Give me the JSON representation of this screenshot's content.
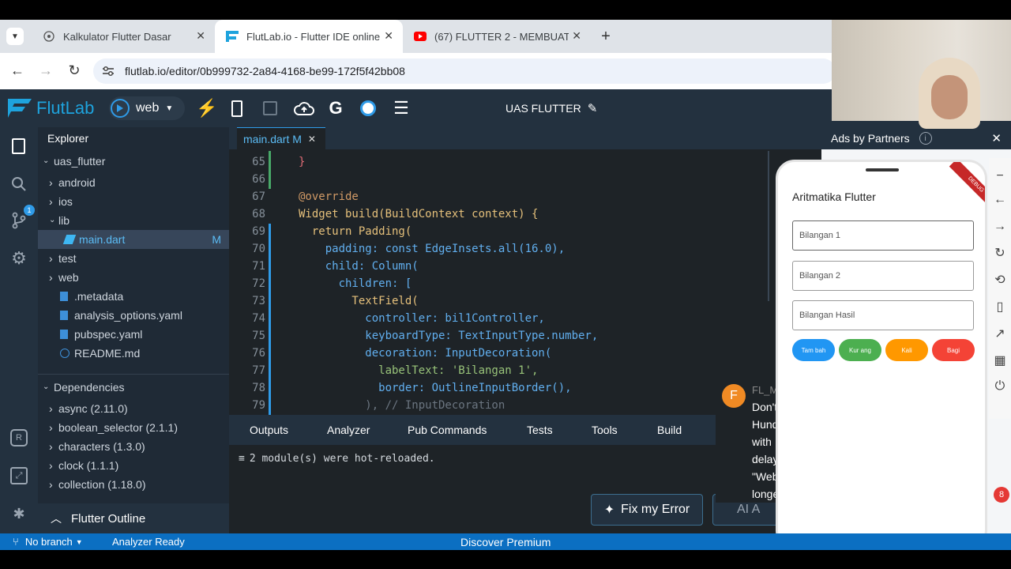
{
  "browser": {
    "tabs": [
      {
        "title": "Kalkulator Flutter Dasar"
      },
      {
        "title": "FlutLab.io - Flutter IDE online"
      },
      {
        "title": "(67) FLUTTER 2 - MEMBUAT KA"
      }
    ],
    "url": "flutlab.io/editor/0b999732-2a84-4168-be99-172f5f42bb08"
  },
  "toolbar": {
    "brand": "FlutLab",
    "target": "web",
    "project_title": "UAS FLUTTER"
  },
  "explorer": {
    "title": "Explorer",
    "root": "uas_flutter",
    "items": [
      {
        "label": "android"
      },
      {
        "label": "ios"
      },
      {
        "label": "lib"
      },
      {
        "label": "main.dart",
        "badge": "M"
      },
      {
        "label": "test"
      },
      {
        "label": "web"
      },
      {
        "label": ".metadata"
      },
      {
        "label": "analysis_options.yaml"
      },
      {
        "label": "pubspec.yaml"
      },
      {
        "label": "README.md"
      }
    ],
    "dependencies_title": "Dependencies",
    "dependencies": [
      {
        "label": "async (2.11.0)"
      },
      {
        "label": "boolean_selector (2.1.1)"
      },
      {
        "label": "characters (1.3.0)"
      },
      {
        "label": "clock (1.1.1)"
      },
      {
        "label": "collection (1.18.0)"
      }
    ],
    "outline_title": "Flutter Outline",
    "source_control_badge": "1"
  },
  "editor": {
    "tab_label": "main.dart M",
    "lines": [
      {
        "n": "65",
        "text": "}"
      },
      {
        "n": "66",
        "text": ""
      },
      {
        "n": "67",
        "text": "@override"
      },
      {
        "n": "68",
        "text": "Widget build(BuildContext context) {"
      },
      {
        "n": "69",
        "text": "  return Padding("
      },
      {
        "n": "70",
        "text": "    padding: const EdgeInsets.all(16.0),"
      },
      {
        "n": "71",
        "text": "    child: Column("
      },
      {
        "n": "72",
        "text": "      children: ["
      },
      {
        "n": "73",
        "text": "        TextField("
      },
      {
        "n": "74",
        "text": "          controller: bil1Controller,"
      },
      {
        "n": "75",
        "text": "          keyboardType: TextInputType.number,"
      },
      {
        "n": "76",
        "text": "          decoration: InputDecoration("
      },
      {
        "n": "77",
        "text": "            labelText: 'Bilangan 1',"
      },
      {
        "n": "78",
        "text": "            border: OutlineInputBorder(),"
      },
      {
        "n": "79",
        "text": "          ), // InputDecoration"
      }
    ]
  },
  "panel": {
    "tabs": [
      {
        "label": "Outputs"
      },
      {
        "label": "Analyzer"
      },
      {
        "label": "Pub Commands"
      },
      {
        "label": "Tests"
      },
      {
        "label": "Tools"
      },
      {
        "label": "Build"
      }
    ],
    "output": "2 module(s) were hot-reloaded.",
    "fix_button": "Fix my Error",
    "ai_button": "AI A"
  },
  "notification": {
    "avatar_letter": "F",
    "title": "FL_M",
    "lines": [
      "Don't",
      "Hund",
      "with",
      "delay",
      "\"Web",
      "longe"
    ]
  },
  "ads": {
    "title": "Ads by Partners"
  },
  "preview": {
    "app_title": "Aritmatika Flutter",
    "banner": "DEBUG",
    "fields": [
      {
        "label": "Bilangan 1"
      },
      {
        "label": "Bilangan 2"
      },
      {
        "label": "Bilangan Hasil"
      }
    ],
    "buttons": [
      {
        "label": "Tam bah",
        "color": "#2196f3"
      },
      {
        "label": "Kur ang",
        "color": "#4caf50"
      },
      {
        "label": "Kali",
        "color": "#ff9800"
      },
      {
        "label": "Bagi",
        "color": "#f44336"
      }
    ]
  },
  "status": {
    "branch": "No branch",
    "analyzer": "Analyzer Ready",
    "premium": "Discover Premium",
    "chat_badge": "8"
  }
}
